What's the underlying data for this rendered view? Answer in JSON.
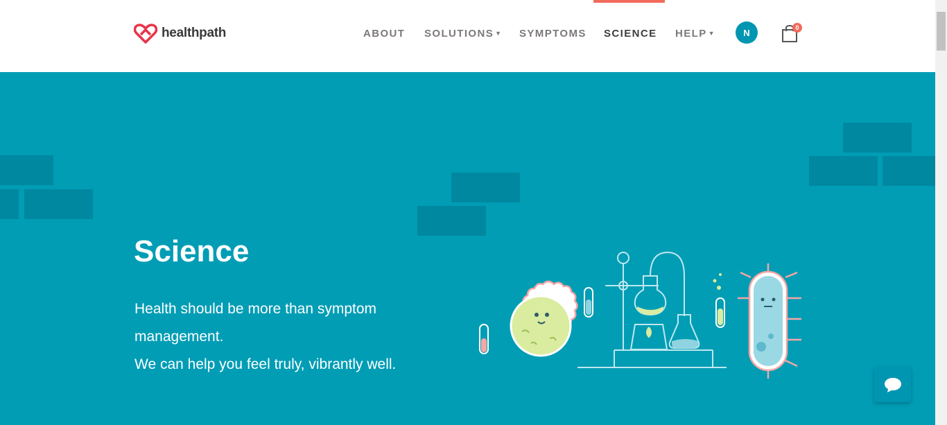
{
  "brand": {
    "name": "healthpath",
    "logo_color": "#e8334a"
  },
  "nav": {
    "items": [
      {
        "label": "ABOUT",
        "has_dropdown": false,
        "active": false
      },
      {
        "label": "SOLUTIONS",
        "has_dropdown": true,
        "active": false
      },
      {
        "label": "SYMPTOMS",
        "has_dropdown": false,
        "active": false
      },
      {
        "label": "SCIENCE",
        "has_dropdown": false,
        "active": true
      },
      {
        "label": "HELP",
        "has_dropdown": true,
        "active": false
      }
    ],
    "active_indicator_color": "#f26a5b"
  },
  "user": {
    "avatar_initial": "N"
  },
  "cart": {
    "count": "0",
    "icon": "shopping-bag-icon"
  },
  "hero": {
    "title": "Science",
    "lines": [
      "Health should be more than symptom",
      "management.",
      "We can help you feel truly, vibrantly well."
    ],
    "background_color": "#009db5",
    "illustration": "lab-scientist-microbes-illustration"
  },
  "chat": {
    "icon": "chat-bubble-icon"
  },
  "colors": {
    "accent": "#f26a5b",
    "teal": "#009db5",
    "teal_dark": "#0088a0",
    "avatar": "#0096b2"
  }
}
